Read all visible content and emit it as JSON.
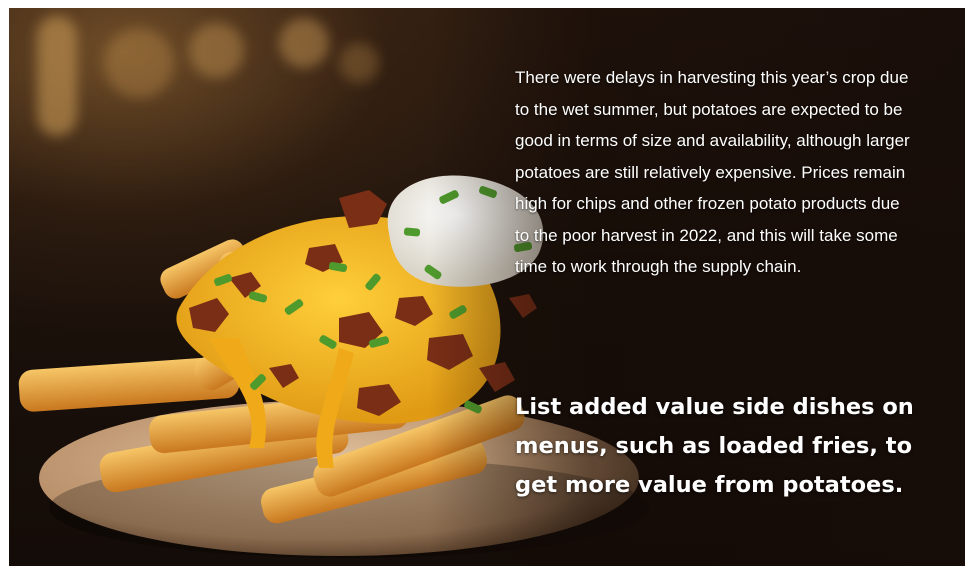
{
  "image": {
    "subject": "loaded-fries-photo",
    "colors": {
      "background": "#1b110b",
      "fries": "#e9a83a",
      "cheese": "#f2b321",
      "bacon": "#7a2e16",
      "chives": "#4f9a2c",
      "sour_cream": "#f4f2ea",
      "plate": "#c9a886",
      "text": "#ffffff"
    }
  },
  "body_text": "There were delays in harvesting this year’s crop due to the wet summer, but potatoes are expected to be good in terms of size and availability, although larger potatoes are still relatively expensive. Prices remain high for chips and other frozen potato products due to the poor harvest in 2022, and this will take some time to work through the supply chain.",
  "tip_text": "List added value side dishes on menus, such as loaded fries, to get more value from potatoes."
}
